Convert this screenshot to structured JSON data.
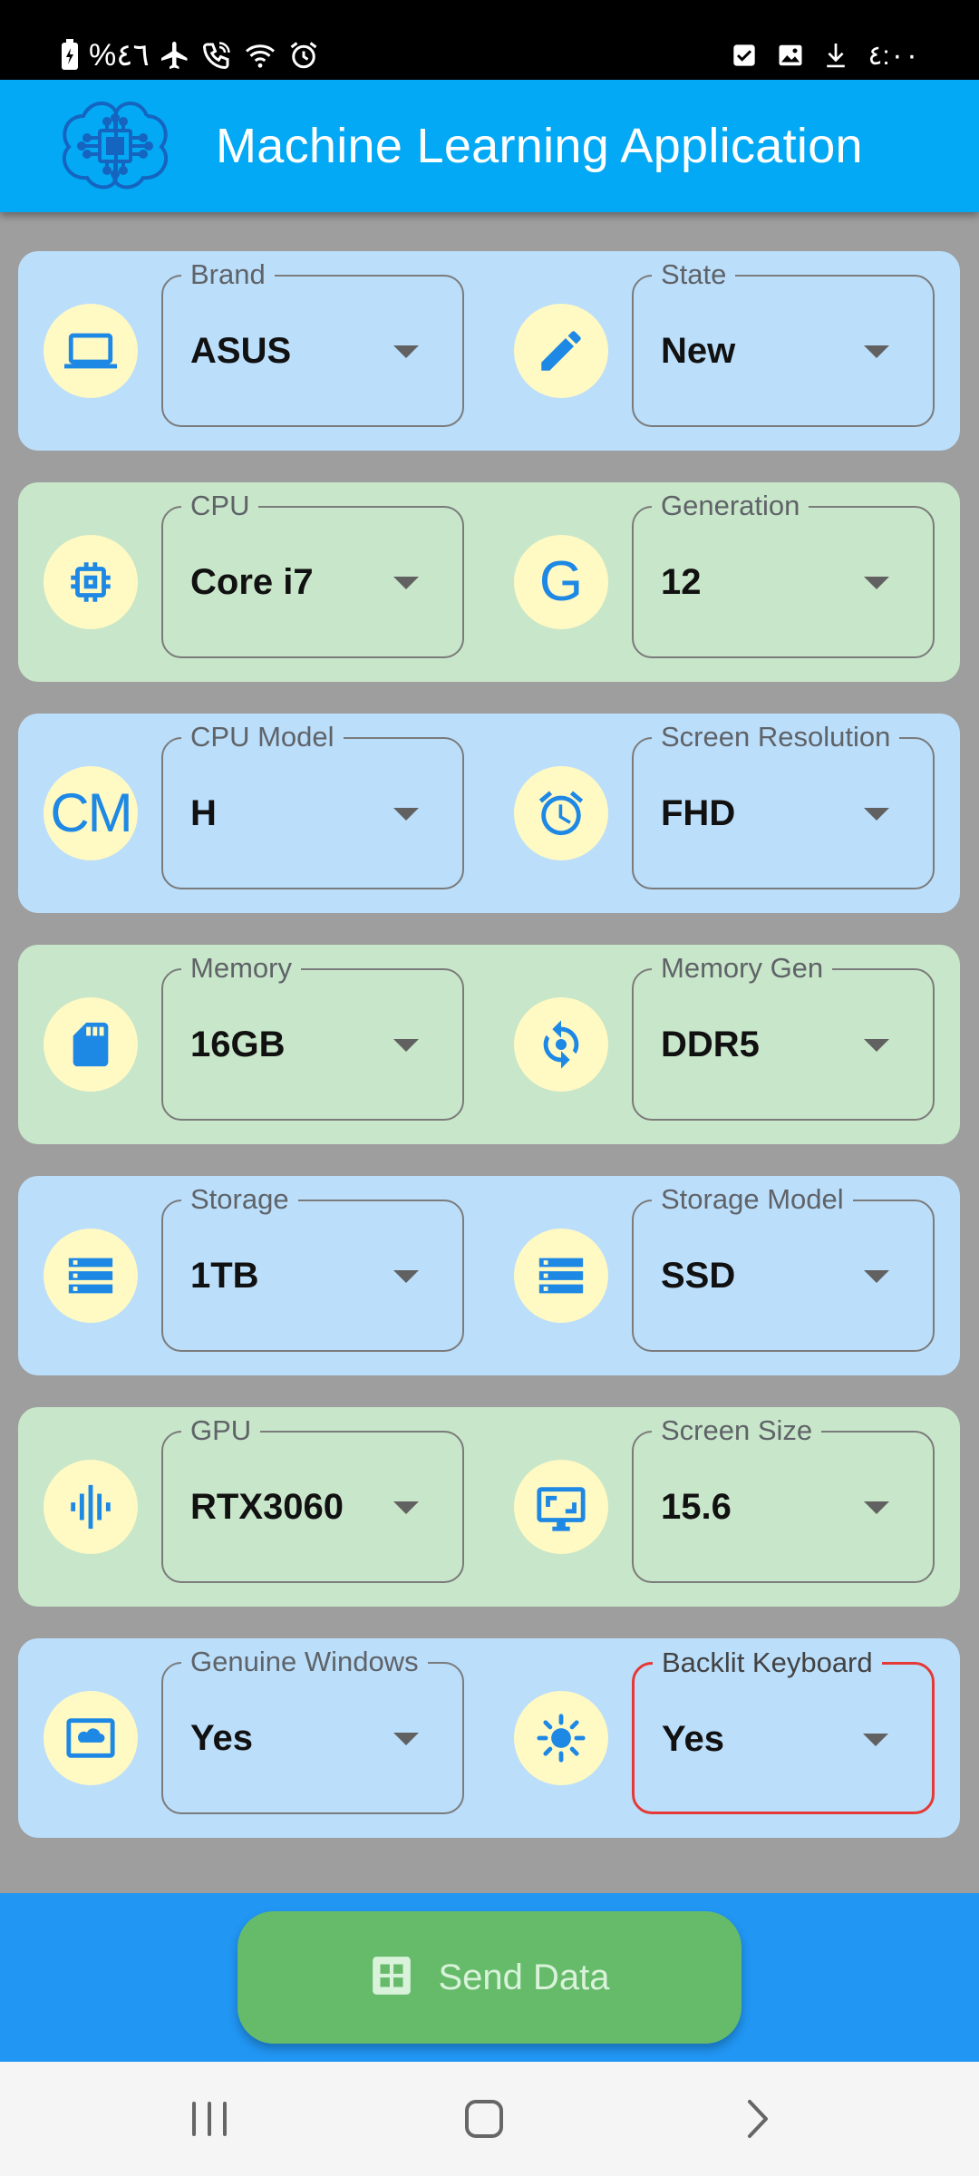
{
  "status_bar": {
    "left_text": "%٤٦",
    "icons_left": [
      "battery-icon",
      "airplane-icon",
      "wifi-call-icon",
      "wifi-icon",
      "alarm-icon"
    ],
    "icons_right": [
      "checkbox-notification-icon",
      "image-notification-icon",
      "download-icon",
      "more-notifications-icon"
    ],
    "right_text": "٤:٠٠"
  },
  "app_bar": {
    "title": "Machine Learning Application",
    "logo_icon": "circuit-brain-icon",
    "background": "#03a9f4"
  },
  "rows": [
    {
      "color": "blue",
      "left": {
        "icon": "laptop-icon",
        "label": "Brand",
        "value": "ASUS"
      },
      "right": {
        "icon": "pencil-icon",
        "label": "State",
        "value": "New"
      }
    },
    {
      "color": "green",
      "left": {
        "icon": "cpu-chip-icon",
        "label": "CPU",
        "value": "Core i7"
      },
      "right": {
        "icon": "letter-g-icon",
        "icon_text": "G",
        "label": "Generation",
        "value": "12"
      }
    },
    {
      "color": "blue",
      "left": {
        "icon": "letters-cm-icon",
        "icon_text": "CM",
        "label": "CPU Model",
        "value": "H"
      },
      "right": {
        "icon": "alarm-clock-icon",
        "label": "Screen Resolution",
        "value": "FHD"
      }
    },
    {
      "color": "green",
      "left": {
        "icon": "sd-card-icon",
        "label": "Memory",
        "value": "16GB"
      },
      "right": {
        "icon": "rotate-icon",
        "label": "Memory Gen",
        "value": "DDR5"
      }
    },
    {
      "color": "blue",
      "left": {
        "icon": "storage-icon",
        "label": "Storage",
        "value": "1TB"
      },
      "right": {
        "icon": "storage-icon",
        "label": "Storage Model",
        "value": "SSD"
      }
    },
    {
      "color": "green",
      "left": {
        "icon": "graphic-eq-icon",
        "label": "GPU",
        "value": "RTX3060"
      },
      "right": {
        "icon": "monitor-icon",
        "label": "Screen Size",
        "value": "15.6"
      }
    },
    {
      "color": "blue",
      "left": {
        "icon": "cloud-screen-icon",
        "label": "Genuine Windows",
        "value": "Yes"
      },
      "right": {
        "icon": "brightness-icon",
        "label": "Backlit Keyboard",
        "value": "Yes",
        "error": true
      }
    }
  ],
  "send_button": {
    "label": "Send Data",
    "icon": "grid-icon"
  },
  "nav_bar": {
    "icons": [
      "recents-icon",
      "home-icon",
      "back-icon"
    ]
  },
  "colors": {
    "row_blue": "#bbdefb",
    "row_green": "#c8e6c9",
    "icon_circle": "#fff9c4",
    "icon_blue": "#1e88e5",
    "error_border": "#e53935",
    "send_button": "#66bb6a",
    "bottom_bar": "#2196f3"
  }
}
